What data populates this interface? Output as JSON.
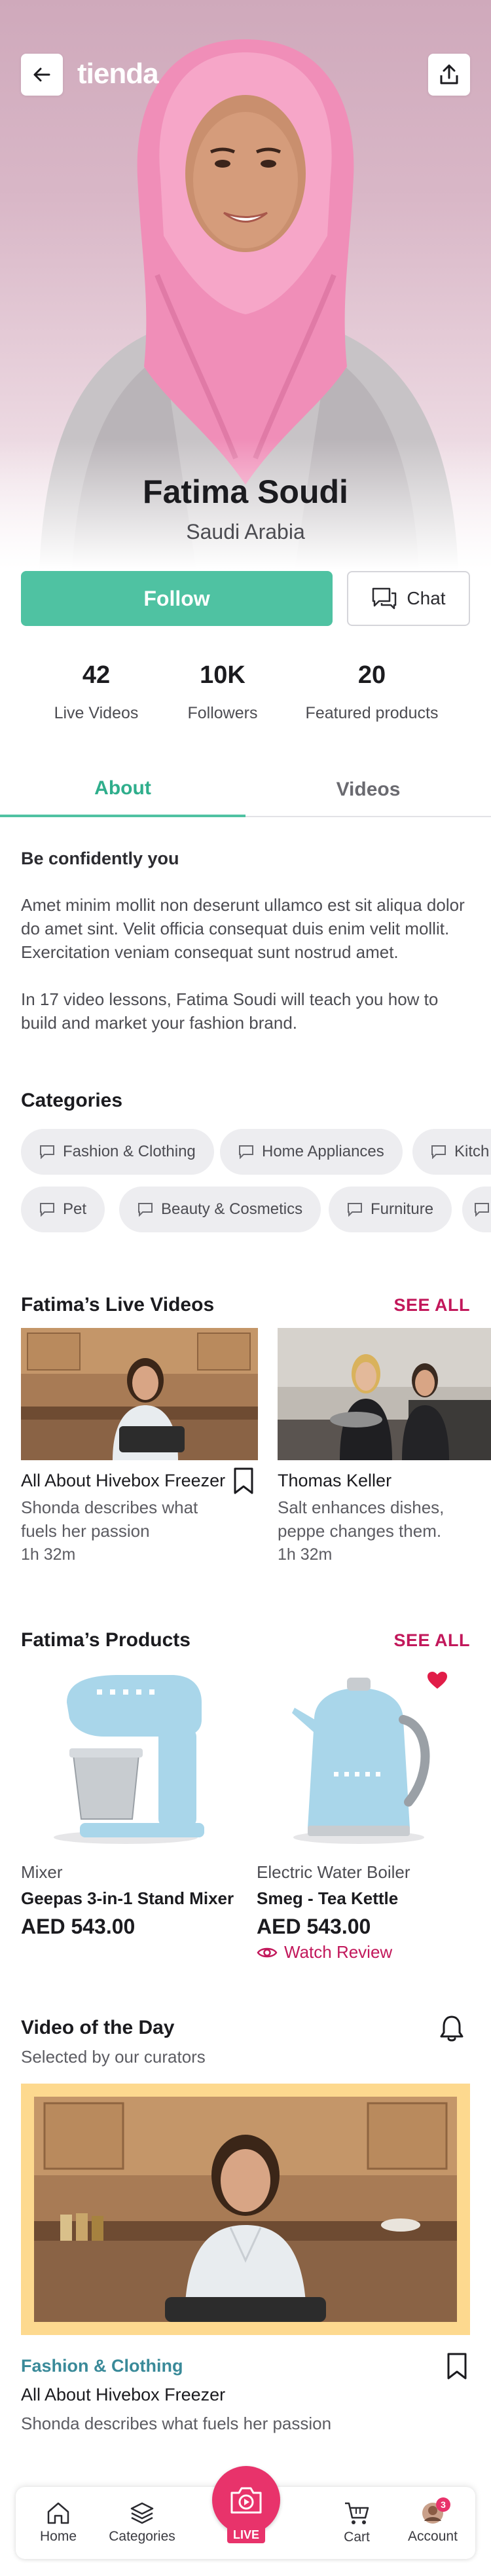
{
  "header": {
    "logo": "tienda",
    "back_icon": "arrow-left-icon",
    "share_icon": "share-icon"
  },
  "creator": {
    "name": "Fatima Soudi",
    "country": "Saudi Arabia"
  },
  "actions": {
    "follow_label": "Follow",
    "chat_label": "Chat"
  },
  "stats": [
    {
      "value": "42",
      "label": "Live Videos"
    },
    {
      "value": "10K",
      "label": "Followers"
    },
    {
      "value": "20",
      "label": "Featured products"
    }
  ],
  "tabs": [
    {
      "label": "About",
      "active": true
    },
    {
      "label": "Videos",
      "active": false
    }
  ],
  "about": {
    "heading": "Be confidently you",
    "paragraph1": "Amet minim mollit non deserunt ullamco est sit aliqua dolor do amet sint. Velit officia consequat duis enim velit mollit. Exercitation veniam consequat sunt nostrud amet.",
    "paragraph2": "In 17 video lessons, Fatima Soudi will teach you how to build and market your fashion brand."
  },
  "categories": {
    "title": "Categories",
    "row1": [
      "Fashion & Clothing",
      "Home Appliances",
      "Kitch"
    ],
    "row2": [
      "Pet",
      "Beauty & Cosmetics",
      "Furniture",
      ""
    ]
  },
  "live_videos": {
    "title": "Fatima’s Live Videos",
    "see_all": "SEE ALL",
    "items": [
      {
        "title": "All About Hivebox Freezer",
        "desc": "Shonda describes what fuels her passion",
        "duration": "1h 32m"
      },
      {
        "title": "Thomas Keller",
        "desc": "Salt enhances dishes, peppe changes them.",
        "duration": "1h 32m"
      }
    ]
  },
  "products": {
    "title": "Fatima’s Products",
    "see_all": "SEE ALL",
    "items": [
      {
        "category": "Mixer",
        "name": "Geepas 3-in-1 Stand Mixer",
        "price": "AED 543.00"
      },
      {
        "category": "Electric Water Boiler",
        "name": "Smeg - Tea Kettle",
        "price": "AED 543.00",
        "watch_review": "Watch Review"
      }
    ]
  },
  "video_of_day": {
    "title": "Video of the Day",
    "subtitle": "Selected by our curators",
    "category": "Fashion & Clothing",
    "video_title": "All About Hivebox Freezer",
    "desc": "Shonda describes what fuels her passion"
  },
  "bottom_nav": {
    "items": [
      "Home",
      "Categories",
      "Cart",
      "Account"
    ],
    "live_label": "LIVE",
    "account_badge": "3"
  },
  "colors": {
    "accent_green": "#4fc2a2",
    "accent_pink": "#c2185b",
    "live_pink": "#e8336b",
    "frame_yellow": "#fdd98f"
  }
}
